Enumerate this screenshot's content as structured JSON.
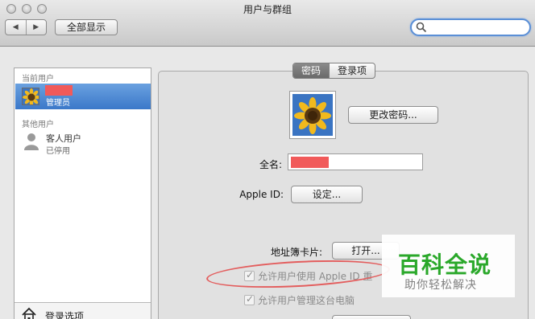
{
  "window": {
    "title": "用户与群组"
  },
  "toolbar": {
    "back_glyph": "◀",
    "forward_glyph": "▶",
    "show_all_label": "全部显示",
    "search_value": ""
  },
  "sidebar": {
    "current_header": "当前用户",
    "current_user": {
      "role": "管理员"
    },
    "other_header": "其他用户",
    "guest": {
      "name": "客人用户",
      "status": "已停用"
    },
    "login_options_label": "登录选项"
  },
  "tabs": [
    {
      "label": "密码",
      "active": true
    },
    {
      "label": "登录项",
      "active": false
    }
  ],
  "main": {
    "change_password_label": "更改密码...",
    "fullname_label": "全名:",
    "apple_id_label": "Apple ID:",
    "apple_id_button": "设定...",
    "address_card_label": "地址簿卡片:",
    "open_button": "打开...",
    "allow_apple_id_reset": "允许用户使用 Apple ID 重",
    "allow_admin": "允许用户管理这台电脑"
  },
  "watermark": {
    "title": "百科全说",
    "subtitle": "助你轻松解决"
  },
  "colors": {
    "selection": "#3b78c9",
    "redaction": "#f15a5a",
    "annotation_ring": "#e35d5d",
    "watermark_green": "#2aa82a"
  }
}
